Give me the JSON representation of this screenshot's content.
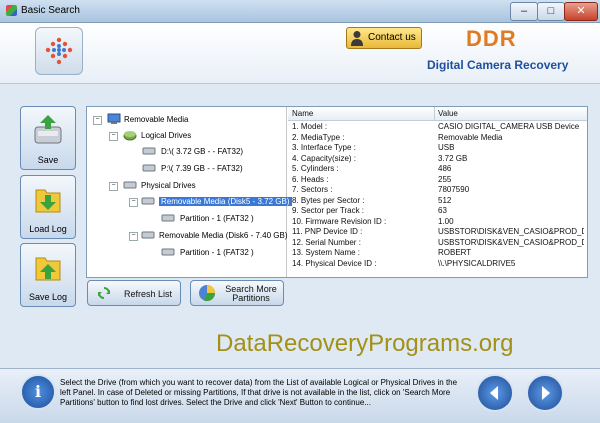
{
  "window": {
    "title": "Basic Search",
    "min": "–",
    "max": "□",
    "close": "✕"
  },
  "header": {
    "contact_label": "Contact us",
    "brand": "DDR",
    "subbrand": "Digital Camera Recovery"
  },
  "sidebar": {
    "save": "Save",
    "load_log": "Load Log",
    "save_log": "Save Log"
  },
  "tree": {
    "root": "Removable Media",
    "logical": "Logical Drives",
    "drive_d": "D:\\( 3.72 GB - - FAT32)",
    "drive_p": "P:\\( 7.39 GB - - FAT32)",
    "physical": "Physical Drives",
    "disk5": "Removable Media (Disk5 - 3.72 GB)",
    "disk5_part": "Partition - 1 (FAT32 )",
    "disk6": "Removable Media (Disk6 - 7.40 GB)",
    "disk6_part": "Partition - 1 (FAT32 )"
  },
  "details": {
    "col_name": "Name",
    "col_value": "Value",
    "rows": [
      {
        "name": "1. Model :",
        "value": "CASIO DIGITAL_CAMERA USB Device"
      },
      {
        "name": "2. MediaType :",
        "value": "Removable Media"
      },
      {
        "name": "3. Interface Type :",
        "value": "USB"
      },
      {
        "name": "4. Capacity(size) :",
        "value": "3.72 GB"
      },
      {
        "name": "5. Cylinders :",
        "value": "486"
      },
      {
        "name": "6. Heads :",
        "value": "255"
      },
      {
        "name": "7. Sectors :",
        "value": "7807590"
      },
      {
        "name": "8. Bytes per Sector :",
        "value": "512"
      },
      {
        "name": "9. Sector per Track :",
        "value": "63"
      },
      {
        "name": "10. Firmware Revision ID :",
        "value": "1.00"
      },
      {
        "name": "11. PNP Device ID :",
        "value": "USBSTOR\\DISK&VEN_CASIO&PROD_D..."
      },
      {
        "name": "12. Serial Number :",
        "value": "USBSTOR\\DISK&VEN_CASIO&PROD_D..."
      },
      {
        "name": "13. System Name :",
        "value": "ROBERT"
      },
      {
        "name": "14. Physical Device ID :",
        "value": "\\\\.\\PHYSICALDRIVE5"
      }
    ]
  },
  "buttons": {
    "refresh": "Refresh List",
    "search_more_1": "Search More",
    "search_more_2": "Partitions"
  },
  "site": "DataRecoveryPrograms.org",
  "footer": {
    "info_icon": "i",
    "help_1": "Select the Drive (from which you want to recover data) from the List of available Logical or Physical Drives in the",
    "help_2": "left Panel. In case of Deleted or missing Partitions, If that drive is not available in the list, click on 'Search More",
    "help_3": "Partitions' button to find lost drives. Select the Drive and click 'Next' Button to continue..."
  }
}
